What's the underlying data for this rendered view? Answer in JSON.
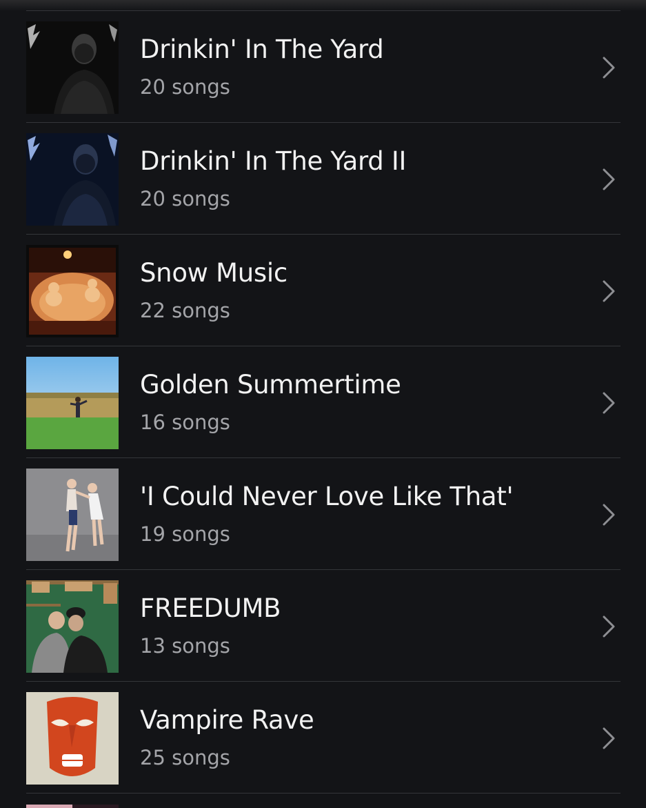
{
  "playlists": [
    {
      "title": "Drinkin' In The Yard",
      "count": "20 songs",
      "art_icon": "artist-portrait-dark"
    },
    {
      "title": "Drinkin' In The Yard II",
      "count": "20 songs",
      "art_icon": "artist-portrait-blue"
    },
    {
      "title": "Snow Music",
      "count": "22 songs",
      "art_icon": "snowmen-night"
    },
    {
      "title": "Golden Summertime",
      "count": "16 songs",
      "art_icon": "field-summer"
    },
    {
      "title": "'I Could Never Love Like That'",
      "count": "19 songs",
      "art_icon": "figurines-grey"
    },
    {
      "title": "FREEDUMB",
      "count": "13 songs",
      "art_icon": "two-men-hats"
    },
    {
      "title": "Vampire Rave",
      "count": "25 songs",
      "art_icon": "red-mask"
    }
  ],
  "chevron_icon": "chevron-right-icon",
  "colors": {
    "background": "#131417",
    "title": "#f2f2f2",
    "subtitle": "#a4a5a9",
    "divider": "#34363a",
    "chevron": "#8e8f93"
  }
}
